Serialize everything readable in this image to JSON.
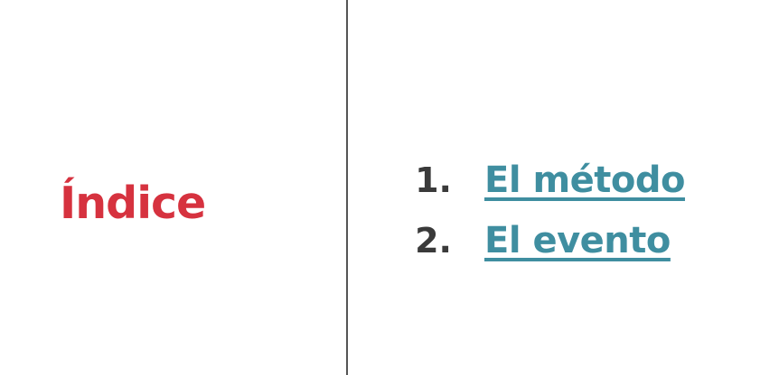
{
  "title": "Índice",
  "items": [
    {
      "number": "1.",
      "label": "El método"
    },
    {
      "number": "2.",
      "label": "El evento"
    }
  ],
  "colors": {
    "title": "#d6323f",
    "number": "#3a3a3a",
    "link": "#3f8ea0",
    "divider": "#555555"
  }
}
